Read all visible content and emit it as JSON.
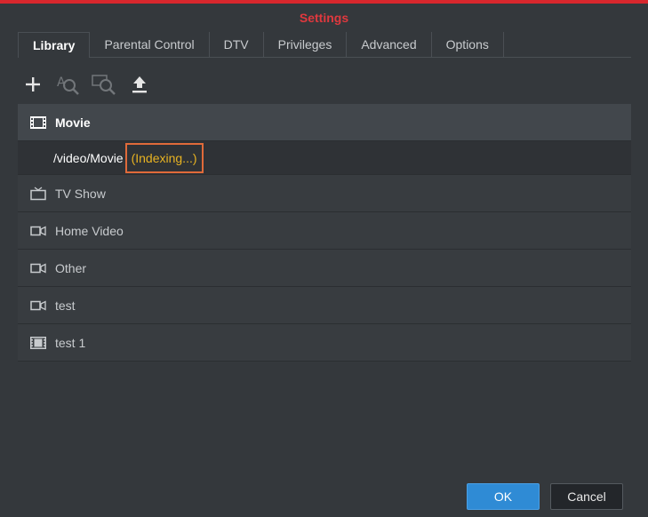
{
  "window": {
    "title": "Settings",
    "accent_color": "#e0383e"
  },
  "tabs": [
    {
      "label": "Library",
      "active": true
    },
    {
      "label": "Parental Control",
      "active": false
    },
    {
      "label": "DTV",
      "active": false
    },
    {
      "label": "Privileges",
      "active": false
    },
    {
      "label": "Advanced",
      "active": false
    },
    {
      "label": "Options",
      "active": false
    }
  ],
  "toolbar": {
    "buttons": [
      {
        "icon": "plus-icon",
        "enabled": true
      },
      {
        "icon": "search-text-icon",
        "enabled": false
      },
      {
        "icon": "search-media-icon",
        "enabled": false
      },
      {
        "icon": "upload-icon",
        "enabled": true
      }
    ]
  },
  "library": {
    "items": [
      {
        "label": "Movie",
        "icon": "film-icon",
        "selected": true
      },
      {
        "label": "/video/Movie",
        "status": "(Indexing...)",
        "status_color": "#e8b322"
      },
      {
        "label": "TV Show",
        "icon": "tv-icon"
      },
      {
        "label": "Home Video",
        "icon": "video-camera-icon"
      },
      {
        "label": "Other",
        "icon": "video-camera-icon"
      },
      {
        "label": "test",
        "icon": "video-camera-icon"
      },
      {
        "label": "test 1",
        "icon": "film-icon"
      }
    ]
  },
  "footer": {
    "ok_label": "OK",
    "cancel_label": "Cancel"
  }
}
